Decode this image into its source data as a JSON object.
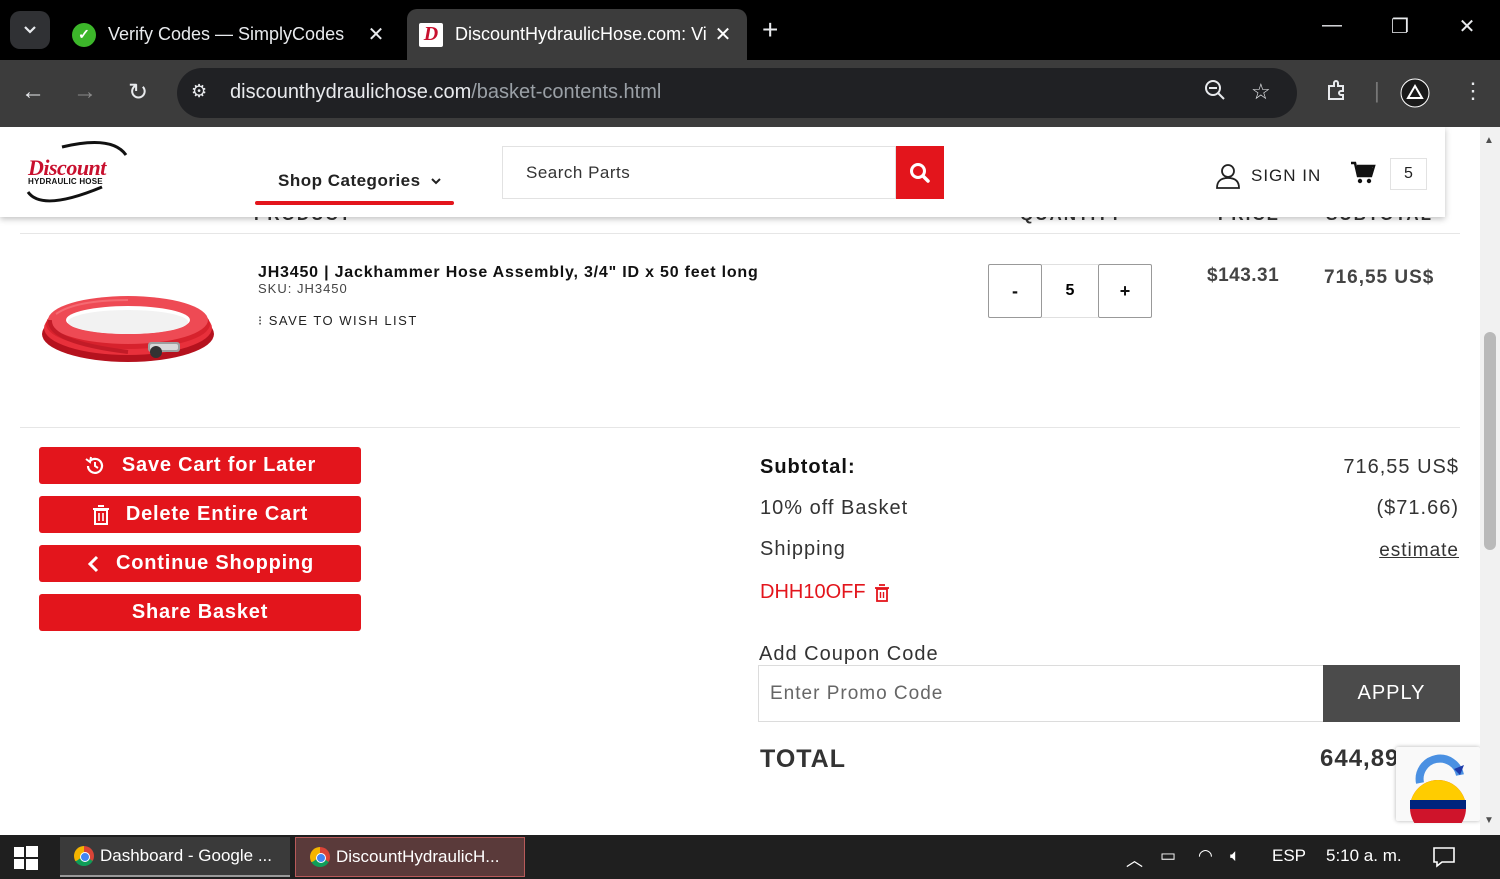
{
  "browser": {
    "tabs": [
      {
        "title": "Verify Codes — SimplyCodes",
        "icon": "simplycodes-icon"
      },
      {
        "title": "DiscountHydraulicHose.com: Vi",
        "icon": "dhh-icon"
      }
    ],
    "url_domain": "discounthydraulichose.com",
    "url_path": "/basket-contents.html"
  },
  "header": {
    "logo_line1": "Discount",
    "logo_line2": "HYDRAULIC HOSE",
    "shop_categories": "Shop Categories",
    "search_placeholder": "Search Parts",
    "sign_in": "SIGN IN",
    "cart_count": "5"
  },
  "table_headers": [
    "PRODUCT",
    "QUANTITY",
    "PRICE",
    "SUBTOTAL"
  ],
  "item": {
    "title": "JH3450 | Jackhammer Hose Assembly, 3/4\" ID x 50 feet long",
    "sku": "SKU: JH3450",
    "wish": "SAVE TO WISH LIST",
    "qty_minus": "-",
    "qty": "5",
    "qty_plus": "+",
    "price": "$143.31",
    "subtotal": "716,55 US$"
  },
  "actions": {
    "save_cart": "Save Cart for Later",
    "delete_cart": "Delete Entire Cart",
    "continue": "Continue Shopping",
    "share": "Share Basket"
  },
  "summary": {
    "subtotal_label": "Subtotal:",
    "subtotal_value": "716,55 US$",
    "discount_label": "10% off Basket",
    "discount_value": "($71.66)",
    "shipping_label": "Shipping",
    "shipping_value": "estimate",
    "coupon_code": "DHH10OFF",
    "add_coupon_label": "Add Coupon Code",
    "promo_placeholder": "Enter Promo Code",
    "apply": "APPLY",
    "total_label": "TOTAL",
    "total_value": "644,89"
  },
  "taskbar": {
    "item1": "Dashboard - Google ...",
    "item2": "DiscountHydraulicH...",
    "lang": "ESP",
    "time": "5:10 a. m."
  },
  "colors": {
    "brand_red": "#e3151c",
    "apply_bg": "#4b4b4b"
  }
}
